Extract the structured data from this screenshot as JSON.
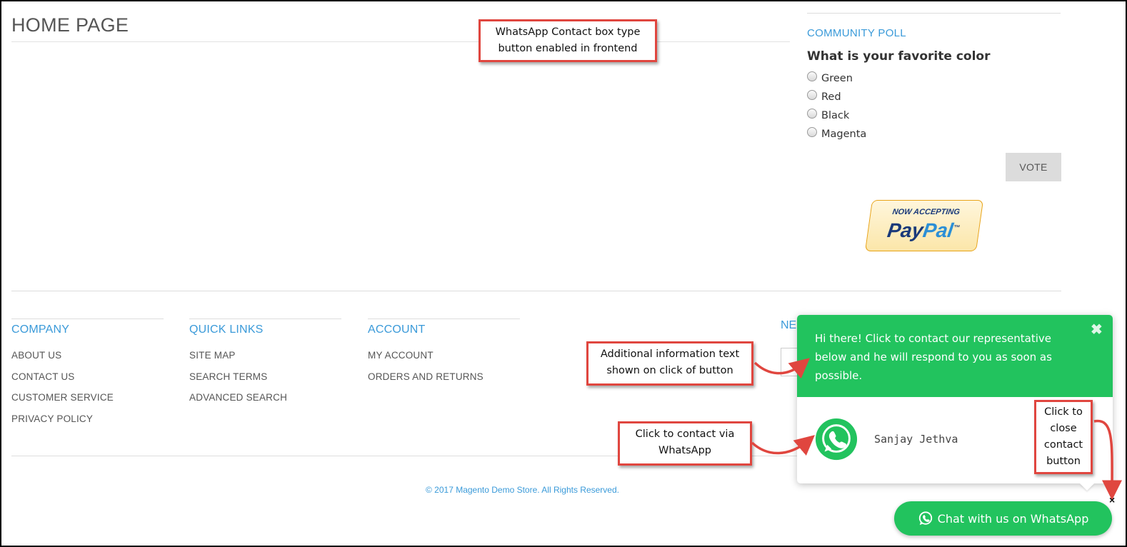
{
  "page": {
    "title": "HOME PAGE"
  },
  "annotations": {
    "top": "WhatsApp Contact box type button enabled in frontend",
    "info": "Additional information text shown on click of button",
    "contact": "Click to contact via WhatsApp",
    "close": "Click to close contact button"
  },
  "poll": {
    "heading": "COMMUNITY POLL",
    "question": "What is your favorite color",
    "options": [
      "Green",
      "Red",
      "Black",
      "Magenta"
    ],
    "vote_label": "VOTE"
  },
  "paypal": {
    "small": "NOW ACCEPTING",
    "pay": "Pay",
    "pal": "Pal",
    "tm": "™"
  },
  "footer": {
    "company": {
      "heading": "COMPANY",
      "links": [
        "ABOUT US",
        "CONTACT US",
        "CUSTOMER SERVICE",
        "PRIVACY POLICY"
      ]
    },
    "quick_links": {
      "heading": "QUICK LINKS",
      "links": [
        "SITE MAP",
        "SEARCH TERMS",
        "ADVANCED SEARCH"
      ]
    },
    "account": {
      "heading": "ACCOUNT",
      "links": [
        "MY ACCOUNT",
        "ORDERS AND RETURNS"
      ]
    },
    "newsletter_fragment": "NE",
    "copyright": "© 2017 Magento Demo Store. All Rights Reserved."
  },
  "whatsapp": {
    "message": "Hi there! Click to contact our representative below and he will respond to you as soon as possible.",
    "close_glyph": "✖",
    "agent_name": "Sanjay Jethva",
    "launch_label": "Chat with us on WhatsApp",
    "launch_close": "×",
    "brand_color": "#22c35e"
  },
  "colors": {
    "accent_blue": "#3a9ad9",
    "callout_red": "#e0463f"
  }
}
